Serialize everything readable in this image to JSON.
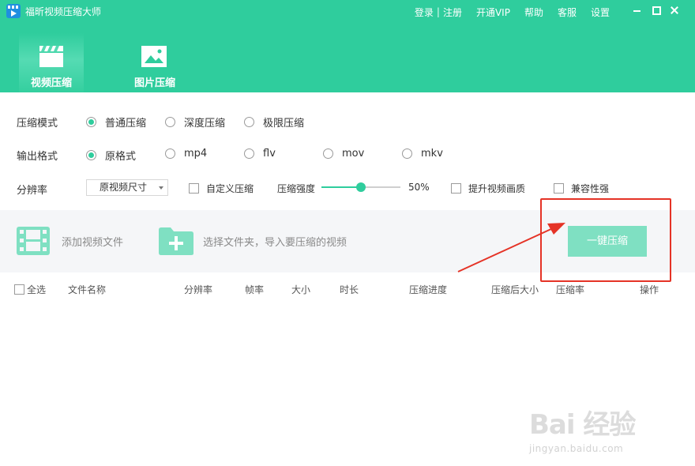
{
  "window": {
    "title": "福昕视频压缩大师",
    "links": [
      "登录",
      "注册",
      "开通VIP",
      "帮助",
      "客服",
      "设置"
    ]
  },
  "tabs": [
    {
      "label": "视频压缩",
      "icon": "clapperboard-icon",
      "active": true
    },
    {
      "label": "图片压缩",
      "icon": "image-icon",
      "active": false
    }
  ],
  "options": {
    "mode": {
      "label": "压缩模式",
      "choices": [
        "普通压缩",
        "深度压缩",
        "极限压缩"
      ],
      "selected": "普通压缩"
    },
    "format": {
      "label": "输出格式",
      "choices": [
        "原格式",
        "mp4",
        "flv",
        "mov",
        "mkv"
      ],
      "selected": "原格式"
    },
    "resolution": {
      "label": "分辨率",
      "value": "原视频尺寸"
    },
    "custom_compress": {
      "label": "自定义压缩",
      "checked": false
    },
    "strength": {
      "label": "压缩强度",
      "value": 50,
      "value_text": "50%"
    },
    "enhance_quality": {
      "label": "提升视频画质",
      "checked": false
    },
    "compatibility": {
      "label": "兼容性强",
      "checked": false
    }
  },
  "actions": {
    "add_file": "添加视频文件",
    "add_folder": "选择文件夹，导入要压缩的视频",
    "compress": "一键压缩"
  },
  "table": {
    "select_all": "全选",
    "columns": [
      "文件名称",
      "分辨率",
      "帧率",
      "大小",
      "时长",
      "压缩进度",
      "压缩后大小",
      "压缩率",
      "操作"
    ]
  },
  "watermark": {
    "brand": "Bai  经验",
    "url": "jingyan.baidu.com"
  },
  "colors": {
    "accent": "#2fcd9d",
    "button": "#7fe0c2",
    "annotation": "#e53326"
  }
}
